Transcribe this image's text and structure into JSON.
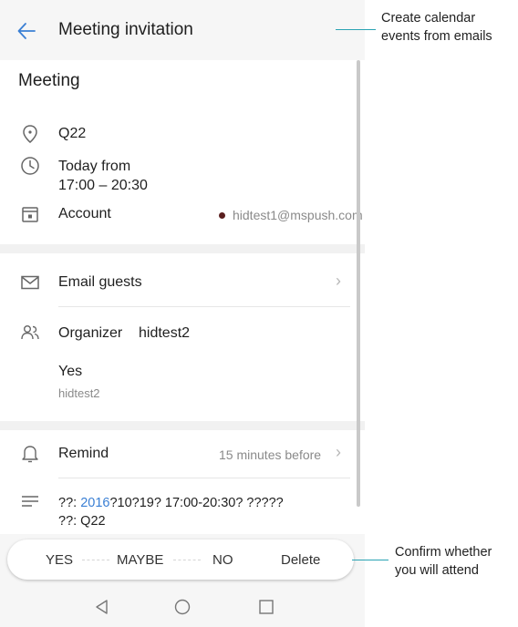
{
  "header": {
    "title": "Meeting invitation",
    "back_icon": "back-arrow-icon"
  },
  "event": {
    "title": "Meeting",
    "location": "Q22",
    "time_line1": "Today from",
    "time_line2": "17:00 – 20:30",
    "account_label": "Account",
    "account_email": "hidtest1@mspush.com",
    "account_dot_color": "#5a1e1e"
  },
  "guests": {
    "email_label": "Email guests",
    "organizer_label": "Organizer",
    "organizer_name": "hidtest2",
    "response": "Yes",
    "response_person": "hidtest2"
  },
  "reminder": {
    "label": "Remind",
    "value": "15 minutes before"
  },
  "description": {
    "line1_prefix": "??: ",
    "line1_year": "2016",
    "line1_rest": "?10?19? 17:00-20:30? ?????",
    "line2": "??: Q22",
    "year_color": "#3a7fd4"
  },
  "actions": {
    "yes": "YES",
    "maybe": "MAYBE",
    "no": "NO",
    "delete": "Delete"
  },
  "navbar": {
    "back": "nav-back-icon",
    "home": "nav-home-icon",
    "recent": "nav-recent-icon"
  },
  "callouts": {
    "top_line1": "Create calendar",
    "top_line2": "events from emails",
    "bottom_line1": "Confirm whether",
    "bottom_line2": "you will attend"
  },
  "colors": {
    "accent": "#3a7fd4",
    "callout_line": "#2aa3b3"
  }
}
